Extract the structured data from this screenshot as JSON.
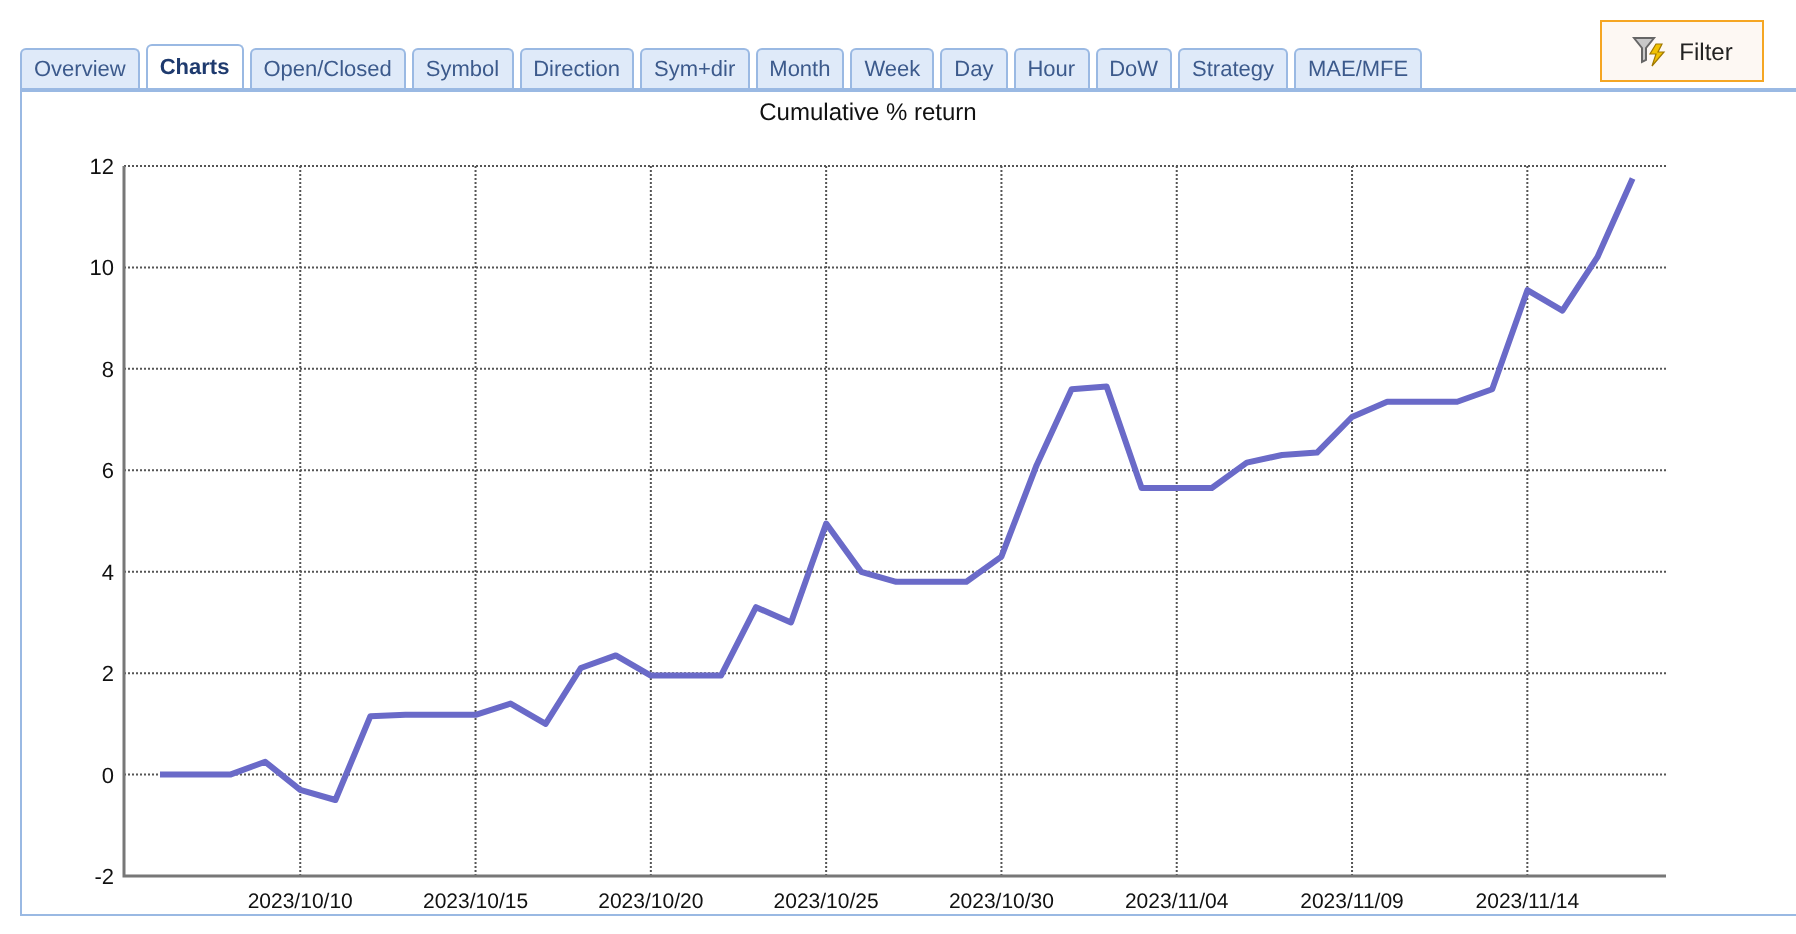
{
  "tabs": [
    {
      "label": "Overview",
      "selected": false
    },
    {
      "label": "Charts",
      "selected": true
    },
    {
      "label": "Open/Closed",
      "selected": false
    },
    {
      "label": "Symbol",
      "selected": false
    },
    {
      "label": "Direction",
      "selected": false
    },
    {
      "label": "Sym+dir",
      "selected": false
    },
    {
      "label": "Month",
      "selected": false
    },
    {
      "label": "Week",
      "selected": false
    },
    {
      "label": "Day",
      "selected": false
    },
    {
      "label": "Hour",
      "selected": false
    },
    {
      "label": "DoW",
      "selected": false
    },
    {
      "label": "Strategy",
      "selected": false
    },
    {
      "label": "MAE/MFE",
      "selected": false
    }
  ],
  "filter_button": {
    "label": "Filter"
  },
  "chart": {
    "chart_data": {
      "type": "line",
      "title": "Cumulative % return",
      "grid": true,
      "categories": [
        null,
        null,
        null,
        null,
        "2023/10/10",
        null,
        null,
        null,
        null,
        "2023/10/15",
        null,
        null,
        null,
        null,
        "2023/10/20",
        null,
        null,
        null,
        null,
        "2023/10/25",
        null,
        null,
        null,
        null,
        "2023/10/30",
        null,
        null,
        null,
        null,
        "2023/11/04",
        null,
        null,
        null,
        null,
        "2023/11/09",
        null,
        null,
        null,
        null,
        "2023/11/14",
        null,
        null,
        null
      ],
      "series": [
        {
          "color": "#6a6ac8",
          "values": [
            0,
            0,
            0,
            0.25,
            -0.3,
            -0.5,
            1.15,
            1.18,
            1.18,
            1.18,
            1.4,
            1.0,
            2.1,
            2.35,
            1.95,
            1.95,
            1.95,
            3.3,
            3.0,
            4.95,
            4.0,
            3.8,
            3.8,
            3.8,
            4.3,
            6.1,
            7.6,
            7.65,
            5.65,
            5.65,
            5.65,
            6.15,
            6.3,
            6.35,
            7.05,
            7.35,
            7.35,
            7.35,
            7.6,
            9.55,
            9.15,
            10.2,
            11.75
          ]
        }
      ],
      "ylim": [
        -2,
        12
      ],
      "yticks": [
        -2,
        0,
        2,
        4,
        6,
        8,
        10,
        12
      ]
    }
  }
}
